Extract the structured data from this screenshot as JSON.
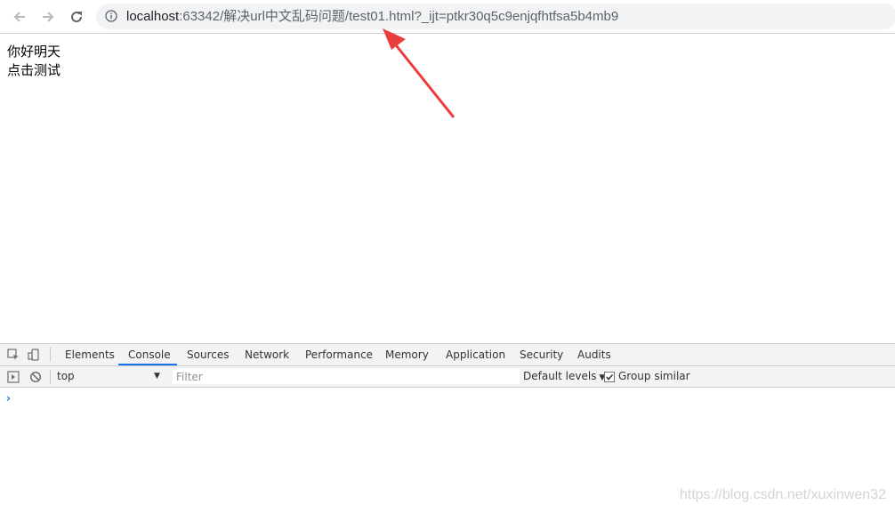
{
  "browser": {
    "url_host": "localhost",
    "url_path": ":63342/解决url中文乱码问题/test01.html?_ijt=ptkr30q5c9enjqfhtfsa5b4mb9",
    "icons": [
      "back-arrow-icon",
      "forward-arrow-icon",
      "reload-icon",
      "info-icon"
    ]
  },
  "page": {
    "line1": "你好明天",
    "line2": "点击测试"
  },
  "annotation": {
    "color": "#ea3d3d"
  },
  "devtools": {
    "tabs": [
      "Elements",
      "Console",
      "Sources",
      "Network",
      "Performance",
      "Memory",
      "Application",
      "Security",
      "Audits"
    ],
    "active_tab": "Console",
    "context": "top",
    "filter_placeholder": "Filter",
    "levels": "Default levels",
    "group_similar": "Group similar",
    "group_similar_checked": true,
    "prompt": "›"
  },
  "watermark": "https://blog.csdn.net/xuxinwen32"
}
